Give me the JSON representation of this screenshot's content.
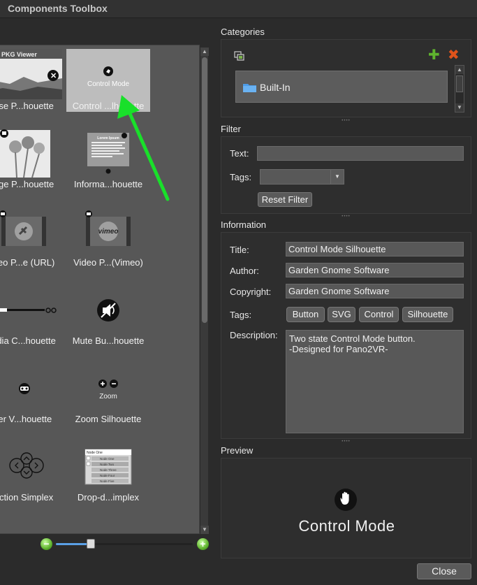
{
  "window": {
    "title": "Components Toolbox"
  },
  "palette": {
    "tiles": [
      {
        "name": "ose P...houette",
        "thumb_text": "PKG Viewer"
      },
      {
        "name": "Control ...lhouette",
        "thumb_text": "Control Mode",
        "selected": true
      },
      {
        "name": "age P...houette"
      },
      {
        "name": "Informa...houette",
        "thumb_text": "Lorem Ipsum",
        "thumb_body": "Lorem ipsum dolor sit amet, consectetur adipiscing elit. Sed feugiat tellus elit varius. Aenean cursus, lorem eros vehicula."
      },
      {
        "name": "deo P...e (URL)"
      },
      {
        "name": "Video P...(Vimeo)",
        "thumb_text": "vimeo"
      },
      {
        "name": "edia C...houette"
      },
      {
        "name": "Mute Bu...houette"
      },
      {
        "name": "ter V...houette"
      },
      {
        "name": "Zoom Silhouette",
        "thumb_text": "Zoom"
      },
      {
        "name": "ection Simplex"
      },
      {
        "name": "Drop-d...implex",
        "thumb_items": [
          "Node One",
          "Node One",
          "Node Two",
          "Node Three",
          "Node Four",
          "Node Five"
        ]
      }
    ]
  },
  "categories": {
    "title": "Categories",
    "items": [
      {
        "label": "Built-In"
      }
    ]
  },
  "filter": {
    "title": "Filter",
    "text_label": "Text:",
    "text_value": "",
    "tags_label": "Tags:",
    "tags_value": "",
    "reset_label": "Reset Filter"
  },
  "information": {
    "title": "Information",
    "title_label": "Title:",
    "title_value": "Control Mode Silhouette",
    "author_label": "Author:",
    "author_value": "Garden Gnome Software",
    "copyright_label": "Copyright:",
    "copyright_value": "Garden Gnome Software",
    "tags_label": "Tags:",
    "tags": [
      "Button",
      "SVG",
      "Control",
      "Silhouette"
    ],
    "description_label": "Description:",
    "description_value": "Two state Control Mode button.\n-Designed for Pano2VR-"
  },
  "preview": {
    "title": "Preview",
    "caption": "Control Mode"
  },
  "footer": {
    "close_label": "Close"
  },
  "colors": {
    "accent_green": "#19e02a",
    "add_green": "#5fb32e",
    "remove_orange": "#e0531b",
    "folder_blue": "#4d9be6"
  }
}
